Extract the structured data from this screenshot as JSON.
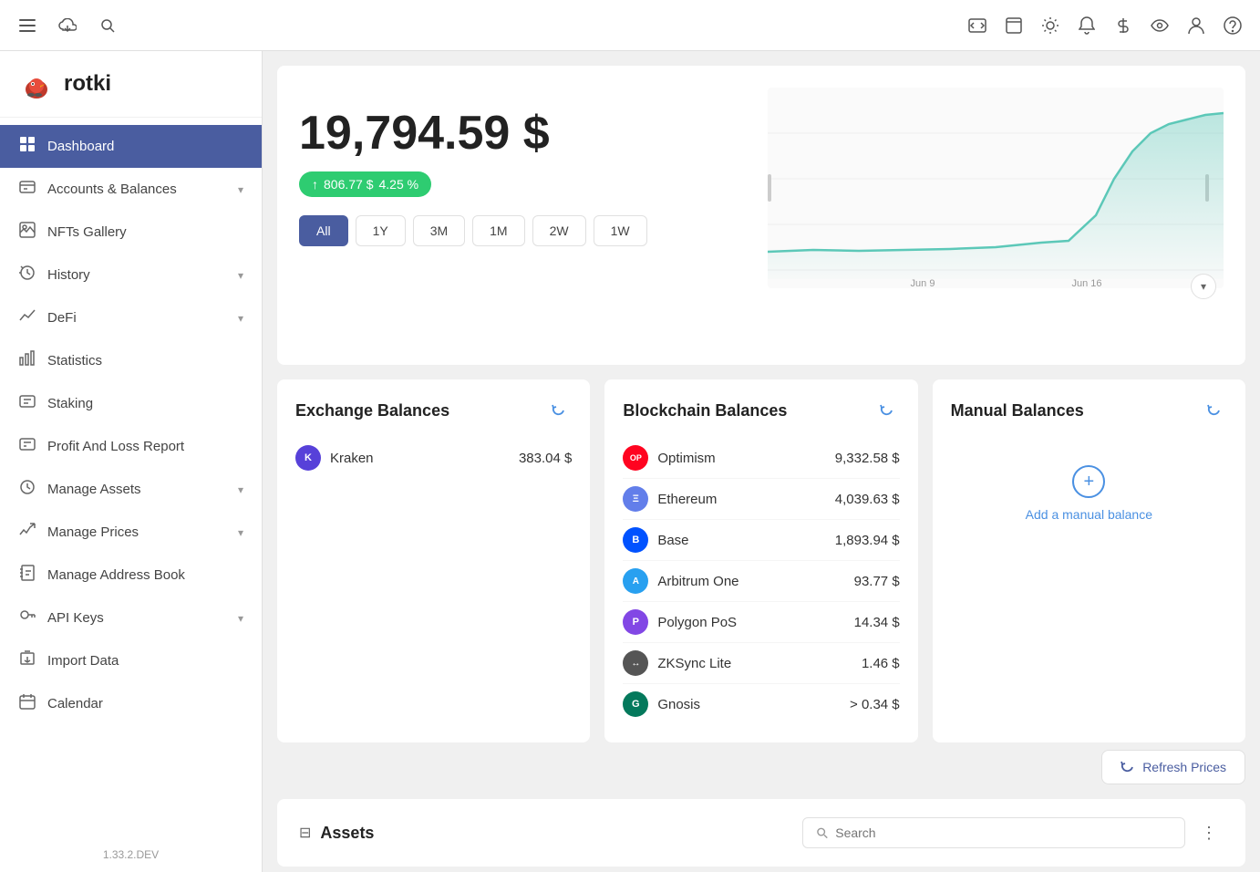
{
  "app": {
    "name": "rotki",
    "version": "1.33.2.DEV"
  },
  "topbar": {
    "icons": [
      "menu",
      "cloud",
      "search",
      "theme",
      "notifications",
      "currency",
      "eye",
      "user",
      "help"
    ]
  },
  "sidebar": {
    "items": [
      {
        "id": "dashboard",
        "label": "Dashboard",
        "icon": "▦",
        "active": true,
        "hasChevron": false
      },
      {
        "id": "accounts-balances",
        "label": "Accounts & Balances",
        "icon": "⊟",
        "active": false,
        "hasChevron": true
      },
      {
        "id": "nfts-gallery",
        "label": "NFTs Gallery",
        "icon": "⊞",
        "active": false,
        "hasChevron": false
      },
      {
        "id": "history",
        "label": "History",
        "icon": "↺",
        "active": false,
        "hasChevron": true
      },
      {
        "id": "defi",
        "label": "DeFi",
        "icon": "⌇",
        "active": false,
        "hasChevron": true
      },
      {
        "id": "statistics",
        "label": "Statistics",
        "icon": "⊞",
        "active": false,
        "hasChevron": false
      },
      {
        "id": "staking",
        "label": "Staking",
        "icon": "⊟",
        "active": false,
        "hasChevron": false
      },
      {
        "id": "profit-loss",
        "label": "Profit And Loss Report",
        "icon": "⊟",
        "active": false,
        "hasChevron": false
      },
      {
        "id": "manage-assets",
        "label": "Manage Assets",
        "icon": "⊟",
        "active": false,
        "hasChevron": true
      },
      {
        "id": "manage-prices",
        "label": "Manage Prices",
        "icon": "⊞",
        "active": false,
        "hasChevron": true
      },
      {
        "id": "manage-address-book",
        "label": "Manage Address Book",
        "icon": "⊟",
        "active": false,
        "hasChevron": false
      },
      {
        "id": "api-keys",
        "label": "API Keys",
        "icon": "⚿",
        "active": false,
        "hasChevron": true
      },
      {
        "id": "import-data",
        "label": "Import Data",
        "icon": "⊟",
        "active": false,
        "hasChevron": false
      },
      {
        "id": "calendar",
        "label": "Calendar",
        "icon": "⊟",
        "active": false,
        "hasChevron": false
      }
    ]
  },
  "dashboard": {
    "total_value": "19,794.59 $",
    "change_amount": "806.77 $",
    "change_percent": "4.25 %",
    "change_direction": "up",
    "time_filters": [
      {
        "label": "All",
        "active": true
      },
      {
        "label": "1Y",
        "active": false
      },
      {
        "label": "3M",
        "active": false
      },
      {
        "label": "1M",
        "active": false
      },
      {
        "label": "2W",
        "active": false
      },
      {
        "label": "1W",
        "active": false
      }
    ],
    "chart_dates": [
      "Jun 9",
      "Jun 16"
    ]
  },
  "exchange_balances": {
    "title": "Exchange Balances",
    "items": [
      {
        "name": "Kraken",
        "value": "383.04 $",
        "icon": "K"
      }
    ]
  },
  "blockchain_balances": {
    "title": "Blockchain Balances",
    "items": [
      {
        "name": "Optimism",
        "value": "9,332.58 $",
        "icon": "OP",
        "color": "icon-optimism"
      },
      {
        "name": "Ethereum",
        "value": "4,039.63 $",
        "icon": "Ξ",
        "color": "icon-ethereum"
      },
      {
        "name": "Base",
        "value": "1,893.94 $",
        "icon": "B",
        "color": "icon-base"
      },
      {
        "name": "Arbitrum One",
        "value": "93.77 $",
        "icon": "A",
        "color": "icon-arbitrum"
      },
      {
        "name": "Polygon PoS",
        "value": "14.34 $",
        "icon": "P",
        "color": "icon-polygon"
      },
      {
        "name": "ZKSync Lite",
        "value": "1.46 $",
        "icon": "Z",
        "color": "icon-zksync"
      },
      {
        "name": "Gnosis",
        "value": "> 0.34 $",
        "icon": "G",
        "color": "icon-gnosis"
      }
    ]
  },
  "manual_balances": {
    "title": "Manual Balances",
    "add_label": "Add a manual balance"
  },
  "refresh_prices_btn": "Refresh Prices",
  "assets_section": {
    "title": "Assets",
    "search_placeholder": "Search"
  }
}
